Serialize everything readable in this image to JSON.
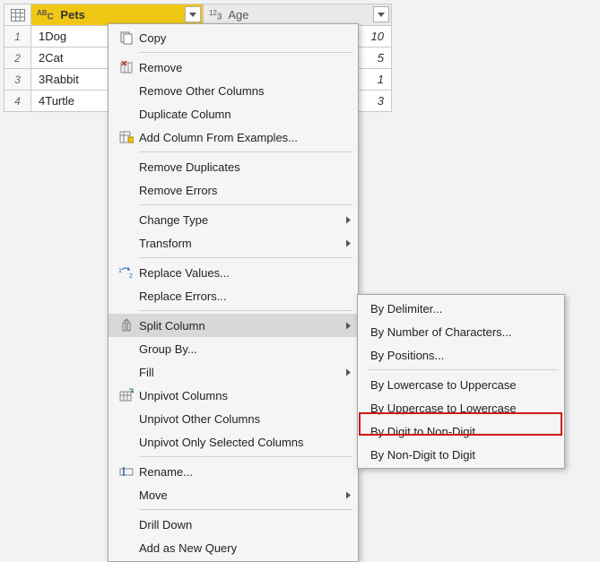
{
  "table": {
    "columns": [
      {
        "name": "Pets",
        "type_label": "ABC"
      },
      {
        "name": "Age",
        "type_label": "123"
      }
    ],
    "rows": [
      {
        "n": "1",
        "pets": "1Dog",
        "age": "10"
      },
      {
        "n": "2",
        "pets": "2Cat",
        "age": "5"
      },
      {
        "n": "3",
        "pets": "3Rabbit",
        "age": "1"
      },
      {
        "n": "4",
        "pets": "4Turtle",
        "age": "3"
      }
    ]
  },
  "menu": {
    "copy": "Copy",
    "remove": "Remove",
    "remove_other": "Remove Other Columns",
    "duplicate": "Duplicate Column",
    "add_from_examples": "Add Column From Examples...",
    "remove_dup": "Remove Duplicates",
    "remove_err": "Remove Errors",
    "change_type": "Change Type",
    "transform": "Transform",
    "replace_values": "Replace Values...",
    "replace_errors": "Replace Errors...",
    "split_column": "Split Column",
    "group_by": "Group By...",
    "fill": "Fill",
    "unpivot": "Unpivot Columns",
    "unpivot_other": "Unpivot Other Columns",
    "unpivot_sel": "Unpivot Only Selected Columns",
    "rename": "Rename...",
    "move": "Move",
    "drill": "Drill Down",
    "add_new_query": "Add as New Query"
  },
  "submenu": {
    "by_delim": "By Delimiter...",
    "by_numchars": "By Number of Characters...",
    "by_pos": "By Positions...",
    "low_to_up": "By Lowercase to Uppercase",
    "up_to_low": "By Uppercase to Lowercase",
    "digit_to_non": "By Digit to Non-Digit",
    "non_to_digit": "By Non-Digit to Digit"
  }
}
